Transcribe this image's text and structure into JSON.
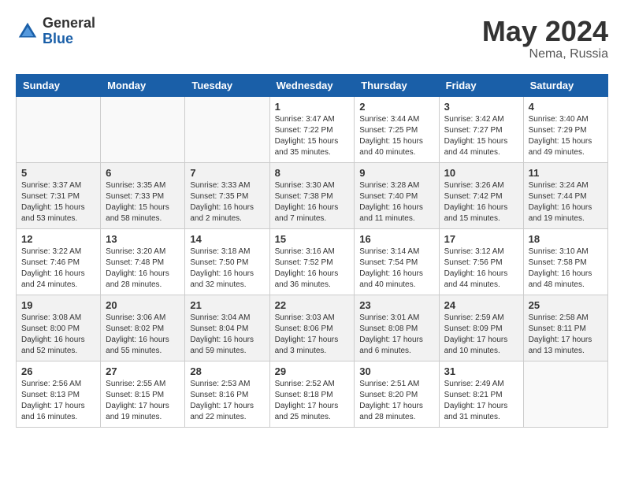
{
  "header": {
    "logo_general": "General",
    "logo_blue": "Blue",
    "month": "May 2024",
    "location": "Nema, Russia"
  },
  "days_of_week": [
    "Sunday",
    "Monday",
    "Tuesday",
    "Wednesday",
    "Thursday",
    "Friday",
    "Saturday"
  ],
  "weeks": [
    {
      "shaded": false,
      "days": [
        {
          "num": "",
          "info": ""
        },
        {
          "num": "",
          "info": ""
        },
        {
          "num": "",
          "info": ""
        },
        {
          "num": "1",
          "info": "Sunrise: 3:47 AM\nSunset: 7:22 PM\nDaylight: 15 hours\nand 35 minutes."
        },
        {
          "num": "2",
          "info": "Sunrise: 3:44 AM\nSunset: 7:25 PM\nDaylight: 15 hours\nand 40 minutes."
        },
        {
          "num": "3",
          "info": "Sunrise: 3:42 AM\nSunset: 7:27 PM\nDaylight: 15 hours\nand 44 minutes."
        },
        {
          "num": "4",
          "info": "Sunrise: 3:40 AM\nSunset: 7:29 PM\nDaylight: 15 hours\nand 49 minutes."
        }
      ]
    },
    {
      "shaded": true,
      "days": [
        {
          "num": "5",
          "info": "Sunrise: 3:37 AM\nSunset: 7:31 PM\nDaylight: 15 hours\nand 53 minutes."
        },
        {
          "num": "6",
          "info": "Sunrise: 3:35 AM\nSunset: 7:33 PM\nDaylight: 15 hours\nand 58 minutes."
        },
        {
          "num": "7",
          "info": "Sunrise: 3:33 AM\nSunset: 7:35 PM\nDaylight: 16 hours\nand 2 minutes."
        },
        {
          "num": "8",
          "info": "Sunrise: 3:30 AM\nSunset: 7:38 PM\nDaylight: 16 hours\nand 7 minutes."
        },
        {
          "num": "9",
          "info": "Sunrise: 3:28 AM\nSunset: 7:40 PM\nDaylight: 16 hours\nand 11 minutes."
        },
        {
          "num": "10",
          "info": "Sunrise: 3:26 AM\nSunset: 7:42 PM\nDaylight: 16 hours\nand 15 minutes."
        },
        {
          "num": "11",
          "info": "Sunrise: 3:24 AM\nSunset: 7:44 PM\nDaylight: 16 hours\nand 19 minutes."
        }
      ]
    },
    {
      "shaded": false,
      "days": [
        {
          "num": "12",
          "info": "Sunrise: 3:22 AM\nSunset: 7:46 PM\nDaylight: 16 hours\nand 24 minutes."
        },
        {
          "num": "13",
          "info": "Sunrise: 3:20 AM\nSunset: 7:48 PM\nDaylight: 16 hours\nand 28 minutes."
        },
        {
          "num": "14",
          "info": "Sunrise: 3:18 AM\nSunset: 7:50 PM\nDaylight: 16 hours\nand 32 minutes."
        },
        {
          "num": "15",
          "info": "Sunrise: 3:16 AM\nSunset: 7:52 PM\nDaylight: 16 hours\nand 36 minutes."
        },
        {
          "num": "16",
          "info": "Sunrise: 3:14 AM\nSunset: 7:54 PM\nDaylight: 16 hours\nand 40 minutes."
        },
        {
          "num": "17",
          "info": "Sunrise: 3:12 AM\nSunset: 7:56 PM\nDaylight: 16 hours\nand 44 minutes."
        },
        {
          "num": "18",
          "info": "Sunrise: 3:10 AM\nSunset: 7:58 PM\nDaylight: 16 hours\nand 48 minutes."
        }
      ]
    },
    {
      "shaded": true,
      "days": [
        {
          "num": "19",
          "info": "Sunrise: 3:08 AM\nSunset: 8:00 PM\nDaylight: 16 hours\nand 52 minutes."
        },
        {
          "num": "20",
          "info": "Sunrise: 3:06 AM\nSunset: 8:02 PM\nDaylight: 16 hours\nand 55 minutes."
        },
        {
          "num": "21",
          "info": "Sunrise: 3:04 AM\nSunset: 8:04 PM\nDaylight: 16 hours\nand 59 minutes."
        },
        {
          "num": "22",
          "info": "Sunrise: 3:03 AM\nSunset: 8:06 PM\nDaylight: 17 hours\nand 3 minutes."
        },
        {
          "num": "23",
          "info": "Sunrise: 3:01 AM\nSunset: 8:08 PM\nDaylight: 17 hours\nand 6 minutes."
        },
        {
          "num": "24",
          "info": "Sunrise: 2:59 AM\nSunset: 8:09 PM\nDaylight: 17 hours\nand 10 minutes."
        },
        {
          "num": "25",
          "info": "Sunrise: 2:58 AM\nSunset: 8:11 PM\nDaylight: 17 hours\nand 13 minutes."
        }
      ]
    },
    {
      "shaded": false,
      "days": [
        {
          "num": "26",
          "info": "Sunrise: 2:56 AM\nSunset: 8:13 PM\nDaylight: 17 hours\nand 16 minutes."
        },
        {
          "num": "27",
          "info": "Sunrise: 2:55 AM\nSunset: 8:15 PM\nDaylight: 17 hours\nand 19 minutes."
        },
        {
          "num": "28",
          "info": "Sunrise: 2:53 AM\nSunset: 8:16 PM\nDaylight: 17 hours\nand 22 minutes."
        },
        {
          "num": "29",
          "info": "Sunrise: 2:52 AM\nSunset: 8:18 PM\nDaylight: 17 hours\nand 25 minutes."
        },
        {
          "num": "30",
          "info": "Sunrise: 2:51 AM\nSunset: 8:20 PM\nDaylight: 17 hours\nand 28 minutes."
        },
        {
          "num": "31",
          "info": "Sunrise: 2:49 AM\nSunset: 8:21 PM\nDaylight: 17 hours\nand 31 minutes."
        },
        {
          "num": "",
          "info": ""
        }
      ]
    }
  ]
}
